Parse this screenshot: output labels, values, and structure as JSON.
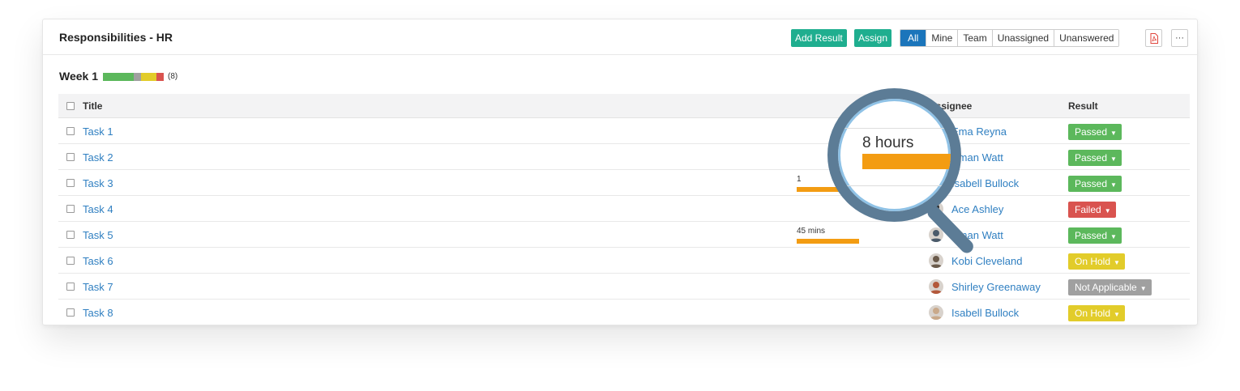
{
  "panel": {
    "title": "Responsibilities - HR",
    "add_result_label": "Add Result",
    "assign_label": "Assign",
    "filters": [
      "All",
      "Mine",
      "Team",
      "Unassigned",
      "Unanswered"
    ],
    "active_filter": "All",
    "pdf_icon": "pdf-icon",
    "more_label": "···"
  },
  "week": {
    "title": "Week 1",
    "count": "(8)",
    "progress": [
      {
        "status": "Passed",
        "share": 0.5,
        "color": "#5cb85c"
      },
      {
        "status": "Not Applicable",
        "share": 0.125,
        "color": "#a0a0a0"
      },
      {
        "status": "On Hold",
        "share": 0.25,
        "color": "#e2cc2a"
      },
      {
        "status": "Failed",
        "share": 0.125,
        "color": "#d9534f"
      }
    ]
  },
  "table": {
    "headers": {
      "title": "Title",
      "assignee": "Assignee",
      "result": "Result"
    },
    "rows": [
      {
        "title": "Task 1",
        "time": "",
        "time_fraction": 0,
        "assignee": "Ema Reyna",
        "result": "Passed",
        "result_color": "#5cb85c"
      },
      {
        "title": "Task 2",
        "time": "",
        "time_fraction": 0,
        "assignee": "Aman Watt",
        "result": "Passed",
        "result_color": "#5cb85c"
      },
      {
        "title": "Task 3",
        "time": "1",
        "time_fraction": 0.4,
        "assignee": "Isabell Bullock",
        "result": "Passed",
        "result_color": "#5cb85c"
      },
      {
        "title": "Task 4",
        "time": "",
        "time_fraction": 0,
        "assignee": "Ace Ashley",
        "result": "Failed",
        "result_color": "#d9534f"
      },
      {
        "title": "Task 5",
        "time": "45 mins",
        "time_fraction": 0.55,
        "assignee": "Aman Watt",
        "result": "Passed",
        "result_color": "#5cb85c"
      },
      {
        "title": "Task 6",
        "time": "",
        "time_fraction": 0,
        "assignee": "Kobi Cleveland",
        "result": "On Hold",
        "result_color": "#e2cc2a"
      },
      {
        "title": "Task 7",
        "time": "",
        "time_fraction": 0,
        "assignee": "Shirley Greenaway",
        "result": "Not Applicable",
        "result_color": "#a0a0a0"
      },
      {
        "title": "Task 8",
        "time": "",
        "time_fraction": 0,
        "assignee": "Isabell Bullock",
        "result": "On Hold",
        "result_color": "#e2cc2a"
      }
    ]
  },
  "magnifier": {
    "text": "8 hours",
    "bar_color": "#f39c12"
  }
}
